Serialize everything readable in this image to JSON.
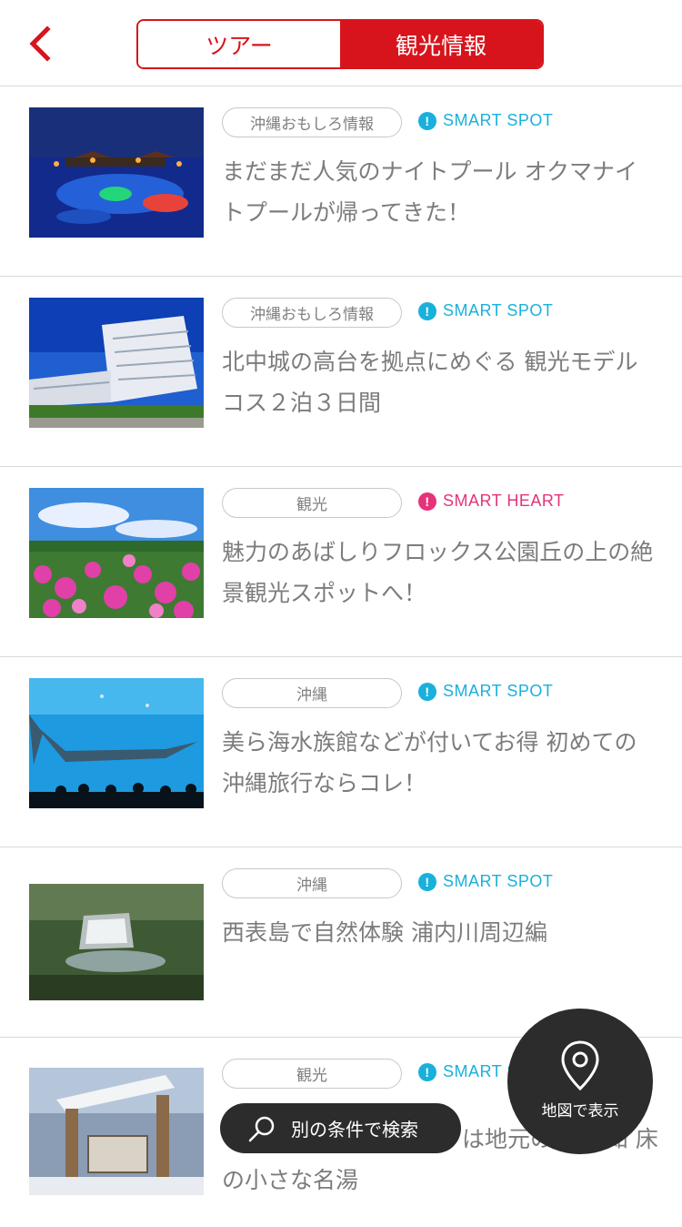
{
  "header": {
    "back_icon": "chevron-left-icon",
    "tabs": [
      "ツアー",
      "観光情報"
    ],
    "active_tab": "観光情報",
    "accent_color": "#d7141c"
  },
  "articles": [
    {
      "tag": "沖縄おもしろ情報",
      "badge": "SMART SPOT",
      "badge_color": "#1ab0dc",
      "title": "まだまだ人気のナイトプール オクマナイトプールが帰ってきた！"
    },
    {
      "tag": "沖縄おもしろ情報",
      "badge": "SMART SPOT",
      "badge_color": "#1ab0dc",
      "title": "北中城の高台を拠点にめぐる 観光モデルコス２泊３日間"
    },
    {
      "tag": "観光",
      "badge": "SMART HEART",
      "badge_color": "#e5337a",
      "title": "魅力のあばしりフロックス公園丘の上の絶景観光スポットへ！"
    },
    {
      "tag": "沖縄",
      "badge": "SMART SPOT",
      "badge_color": "#1ab0dc",
      "title": "美ら海水族館などが付いてお得 初めての沖縄旅行ならコレ！"
    },
    {
      "tag": "沖縄",
      "badge": "SMART SPOT",
      "badge_color": "#1ab0dc",
      "title": "西表島で自然体験 浦内川周辺編"
    },
    {
      "tag": "観光",
      "badge": "SMART SPOT",
      "badge_color": "#1ab0dc",
      "title": "は地元の人も 知 床の小さな名湯"
    }
  ],
  "floating": {
    "search_label": "別の条件で検索",
    "search_icon": "search-icon",
    "map_label": "地図で表示",
    "map_icon": "map-pin-icon"
  }
}
